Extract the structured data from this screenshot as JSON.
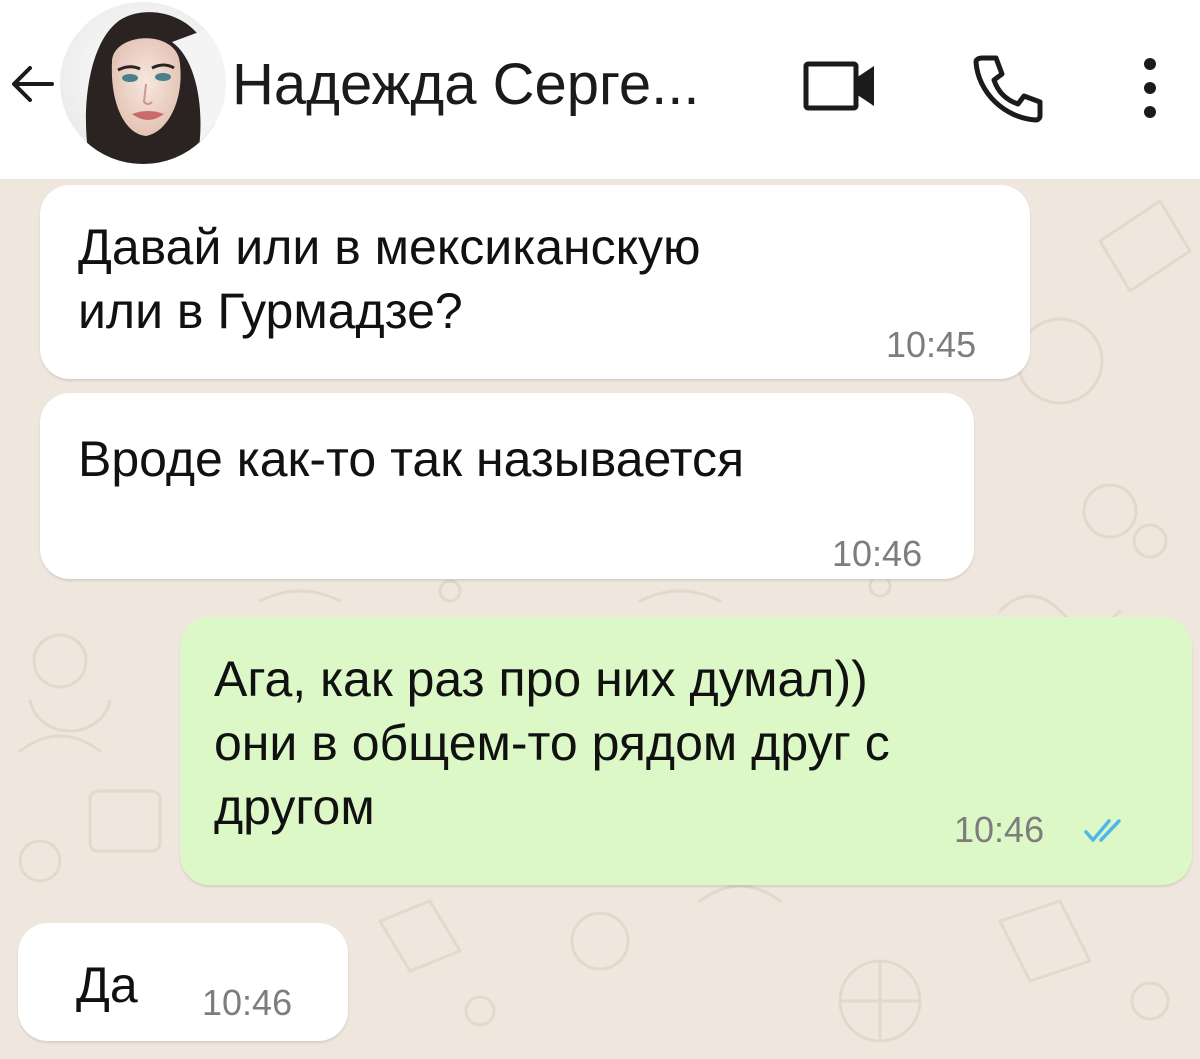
{
  "header": {
    "contact_name": "Надежда Серге...",
    "back_icon": "arrow-left-icon",
    "video_icon": "video-call-icon",
    "call_icon": "phone-icon",
    "menu_icon": "more-vertical-icon"
  },
  "messages": [
    {
      "direction": "incoming",
      "text": "Давай или в мексиканскую\nили в Гурмадзе?",
      "time": "10:45"
    },
    {
      "direction": "incoming",
      "text": "Вроде как-то так называется",
      "time": "10:46"
    },
    {
      "direction": "outgoing",
      "text": "Ага, как раз про них думал))\nони в общем-то рядом друг с\nдругом",
      "time": "10:46",
      "status": "read"
    },
    {
      "direction": "incoming",
      "text": "Да",
      "time": "10:46"
    }
  ],
  "colors": {
    "header_bg": "#ffffff",
    "chat_bg": "#efe7dd",
    "incoming_bubble": "#ffffff",
    "outgoing_bubble": "#dcf8c6",
    "time_text": "#7d7d7d",
    "read_ticks": "#4fb6ec"
  }
}
